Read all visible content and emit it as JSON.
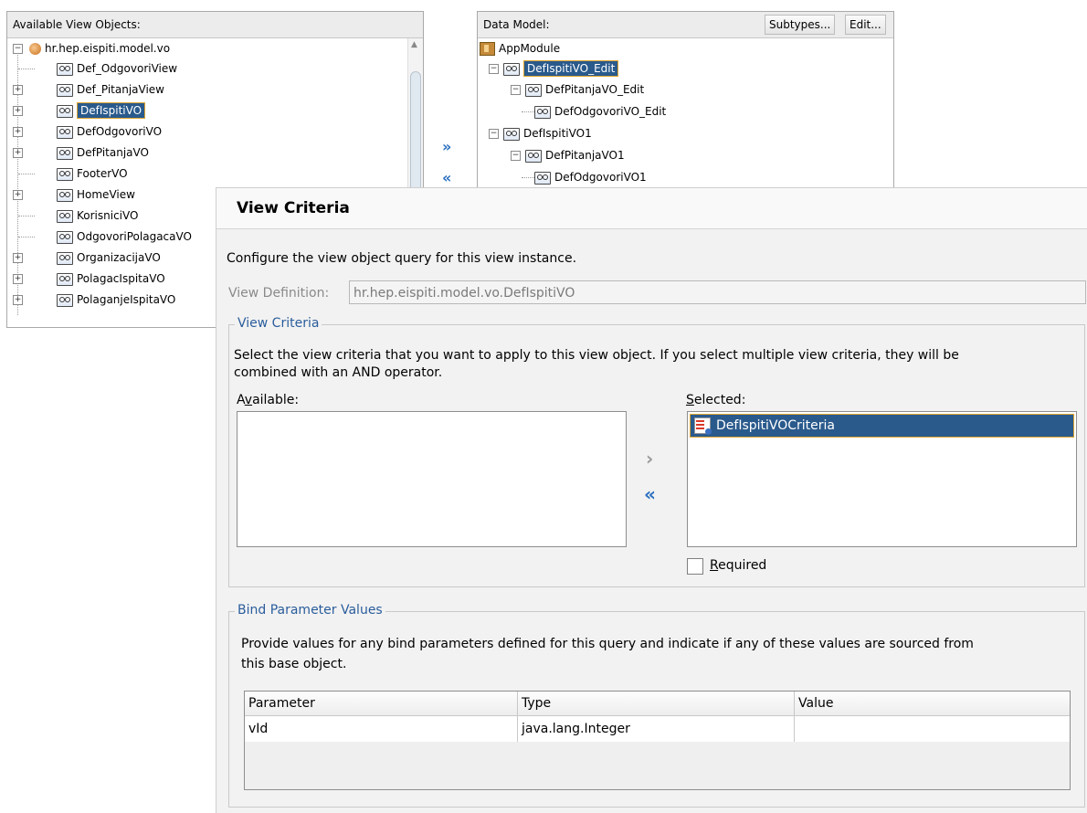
{
  "available_panel": {
    "title": "Available View Objects:",
    "package": "hr.hep.eispiti.model.vo",
    "items": [
      {
        "label": "Def_OdgovoriView",
        "expandable": false
      },
      {
        "label": "Def_PitanjaView",
        "expandable": true
      },
      {
        "label": "DefIspitiVO",
        "expandable": true,
        "selected": true
      },
      {
        "label": "DefOdgovoriVO",
        "expandable": true
      },
      {
        "label": "DefPitanjaVO",
        "expandable": true
      },
      {
        "label": "FooterVO",
        "expandable": false
      },
      {
        "label": "HomeView",
        "expandable": true
      },
      {
        "label": "KorisniciVO",
        "expandable": false
      },
      {
        "label": "OdgovoriPolagacaVO",
        "expandable": false
      },
      {
        "label": "OrganizacijaVO",
        "expandable": true
      },
      {
        "label": "PolagacIspitaVO",
        "expandable": true
      },
      {
        "label": "PolaganjeIspitaVO",
        "expandable": true
      }
    ]
  },
  "data_model_panel": {
    "title": "Data Model:",
    "subtypes_button": "Subtypes...",
    "edit_button": "Edit...",
    "root": "AppModule",
    "nodes": [
      {
        "label": "DefIspitiVO_Edit",
        "selected": true
      },
      {
        "label": "DefPitanjaVO_Edit"
      },
      {
        "label": "DefOdgovoriVO_Edit"
      },
      {
        "label": "DefIspitiVO1"
      },
      {
        "label": "DefPitanjaVO1"
      },
      {
        "label": "DefOdgovoriVO1"
      }
    ]
  },
  "shuttle": {
    "add_icon": "double-chevron-right-icon",
    "remove_icon": "double-chevron-left-icon"
  },
  "dialog": {
    "title": "View Criteria",
    "description": "Configure the view object query for this view instance.",
    "view_definition_label": "View Definition:",
    "view_definition_value": "hr.hep.eispiti.model.vo.DefIspitiVO",
    "view_criteria_group": {
      "legend": "View Criteria",
      "instructions_line1": "Select the view criteria that you want to apply to this view object. If you select multiple view criteria, they will be",
      "instructions_line2": "combined with an AND operator.",
      "available_label_pre": "A",
      "available_label_mn": "v",
      "available_label_post": "ailable:",
      "selected_label_mn": "S",
      "selected_label_post": "elected:",
      "selected_items": [
        "DefIspitiVOCriteria"
      ],
      "required_label_mn": "R",
      "required_label_post": "equired",
      "required_checked": false
    },
    "bind_group": {
      "legend": "Bind Parameter Values",
      "instructions_line1": "Provide values for any bind parameters defined for this query and indicate if any of these values are sourced from",
      "instructions_line2": "this base object.",
      "columns": [
        "Parameter",
        "Type",
        "Value"
      ],
      "rows": [
        {
          "parameter": "vId",
          "type": "java.lang.Integer",
          "value": ""
        }
      ]
    }
  },
  "colors": {
    "selection": "#2a5a8c",
    "selection_border": "#e0a630",
    "legend": "#2a5d9c",
    "shuttle_arrow": "#2a6fbf"
  }
}
